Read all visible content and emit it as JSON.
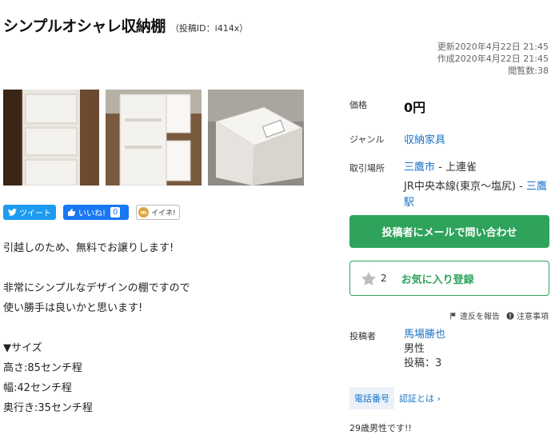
{
  "post": {
    "title": "シンプルオシャレ収納棚",
    "post_id": "（投稿ID：i414x）"
  },
  "meta": {
    "updated": "更新2020年4月22日 21:45",
    "created": "作成2020年4月22日 21:45",
    "views": "閲覧数:38"
  },
  "social": {
    "tweet_label": "ツイート",
    "like_label": "いいね!",
    "like_count": "0",
    "iine_label": "イイネ!"
  },
  "description": "引越しのため、無料でお譲りします!\n\n非常にシンプルなデザインの棚ですので\n使い勝手は良いかと思います!\n\n▼サイズ\n高さ:85センチ程\n幅:42センチ程\n奥行き:35センチ程",
  "details": {
    "price_label": "価格",
    "price_value": "0円",
    "genre_label": "ジャンル",
    "genre_value": "収納家具",
    "place_label": "取引場所",
    "city": "三鷹市",
    "area": " - 上連雀",
    "line": "JR中央本線(東京〜塩尻) - ",
    "station": "三鷹駅"
  },
  "actions": {
    "contact_label": "投稿者にメールで問い合わせ",
    "favorite_count": "2",
    "favorite_label": "お気に入り登録",
    "report_label": "違反を報告",
    "notes_label": "注意事項"
  },
  "poster": {
    "label": "投稿者",
    "name": "馬場勝也",
    "gender": "男性",
    "posts": "投稿：3",
    "phone_label": "電話番号",
    "verify_label": "認証とは ›",
    "bio": "29歳男性です!!"
  },
  "colors": {
    "accent": "#2fa35b",
    "link": "#1a73c8",
    "twitter": "#1d9bf0",
    "facebook": "#1877f2"
  }
}
